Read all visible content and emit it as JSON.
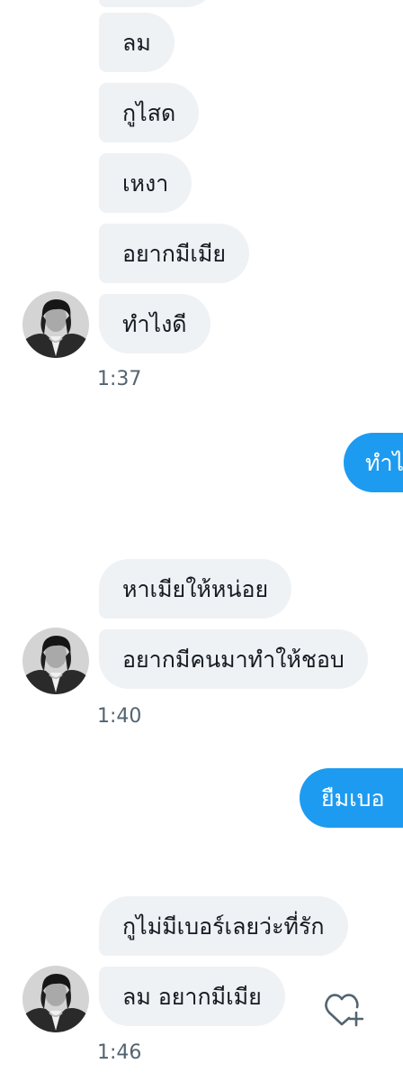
{
  "conversation": {
    "incoming_group_1": {
      "messages": [
        "ลม",
        "กูไสด",
        "เหงา",
        "อยากมีเมีย",
        "ทำไงดี"
      ],
      "time": "1:37"
    },
    "outgoing_1": {
      "text": "ทำไ"
    },
    "incoming_group_2": {
      "messages": [
        "หาเมียให้หน่อย",
        "อยากมีคนมาทำให้ชอบ"
      ],
      "time": "1:40"
    },
    "outgoing_2": {
      "text": "ยืมเบอ"
    },
    "incoming_group_3": {
      "messages": [
        "กูไม่มีเบอร์เลยว่ะที่รัก",
        "ลม อยากมีเมีย"
      ],
      "time": "1:46"
    }
  },
  "icons": {
    "like": "heart-plus-icon",
    "avatar": "avatar-photo"
  },
  "colors": {
    "incoming_bubble": "#eff2f4",
    "outgoing_bubble": "#1d9bf0",
    "timestamp": "#536471",
    "text": "#141b22"
  }
}
